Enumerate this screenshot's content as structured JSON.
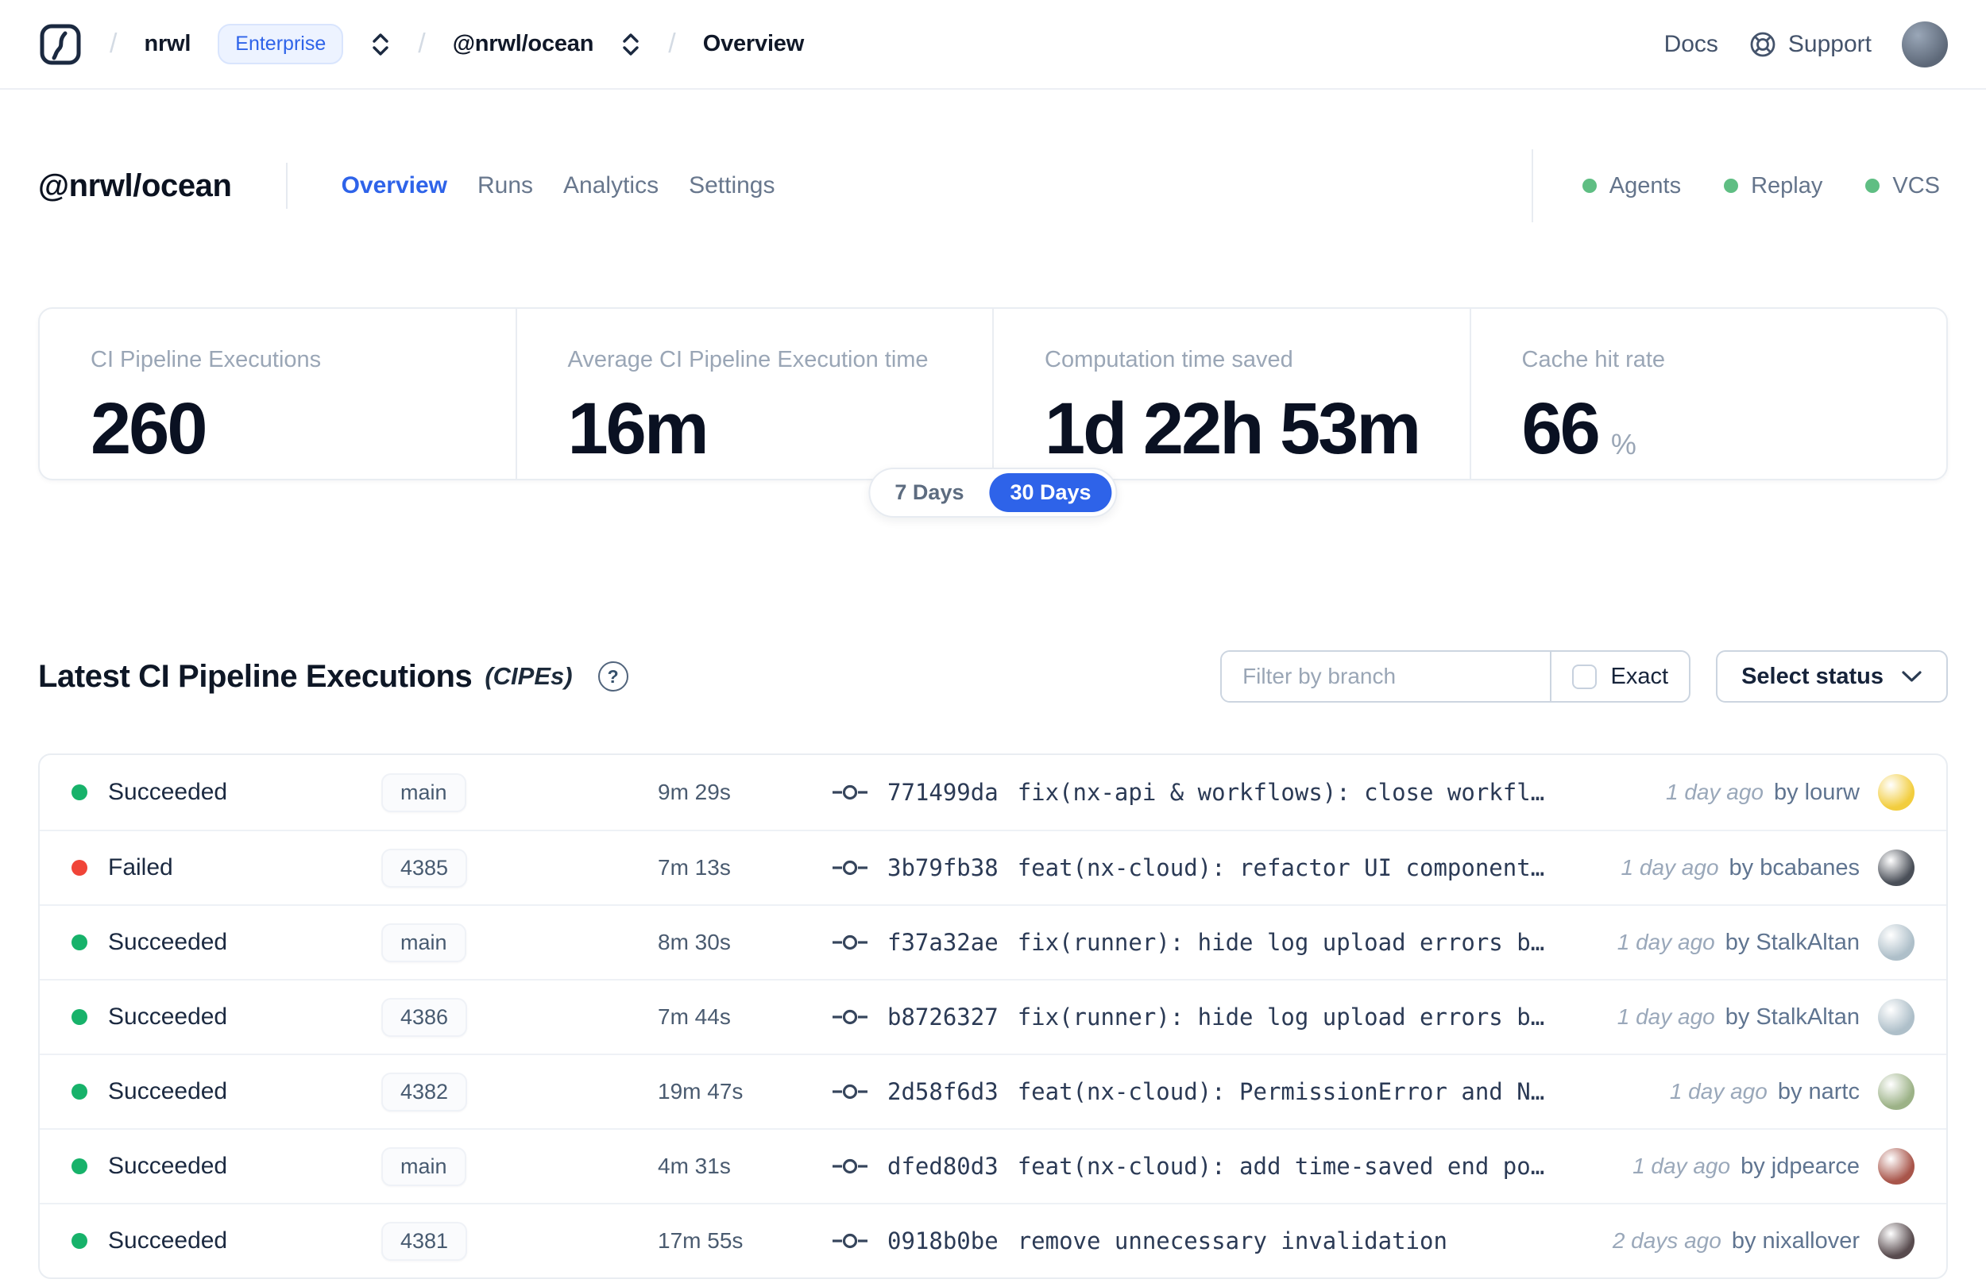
{
  "colors": {
    "primary": "#2e63e9",
    "success_dot": "#17b26a",
    "failed_dot": "#f04438",
    "header_dot": "#5fbe83"
  },
  "nav": {
    "separator": "/",
    "breadcrumb": {
      "org": "nrwl",
      "org_badge": "Enterprise",
      "workspace": "@nrwl/ocean",
      "page": "Overview"
    },
    "links": {
      "docs": "Docs",
      "support": "Support"
    }
  },
  "header": {
    "title": "@nrwl/ocean",
    "tabs": [
      {
        "label": "Overview",
        "active": true
      },
      {
        "label": "Runs",
        "active": false
      },
      {
        "label": "Analytics",
        "active": false
      },
      {
        "label": "Settings",
        "active": false
      }
    ],
    "statuses": [
      {
        "label": "Agents"
      },
      {
        "label": "Replay"
      },
      {
        "label": "VCS"
      }
    ]
  },
  "stats": {
    "cards": [
      {
        "label": "CI Pipeline Executions",
        "value": "260",
        "suffix": ""
      },
      {
        "label": "Average CI Pipeline Execution time",
        "value": "16m",
        "suffix": ""
      },
      {
        "label": "Computation time saved",
        "value": "1d 22h 53m",
        "suffix": ""
      },
      {
        "label": "Cache hit rate",
        "value": "66",
        "suffix": "%"
      }
    ],
    "range_toggle": {
      "options": [
        {
          "label": "7 Days",
          "active": false
        },
        {
          "label": "30 Days",
          "active": true
        }
      ]
    }
  },
  "cipe_section": {
    "title": "Latest CI Pipeline Executions",
    "title_suffix": "(CIPEs)",
    "help_icon": "?",
    "filter": {
      "placeholder": "Filter by branch",
      "exact_label": "Exact"
    },
    "status_select": {
      "label": "Select status"
    }
  },
  "table": {
    "rows": [
      {
        "status": "Succeeded",
        "branch": "main",
        "duration": "9m 29s",
        "commit_hash": "771499da",
        "commit_message": "fix(nx-api & workflows): close workfl…",
        "ago": "1 day ago",
        "author": "by lourw",
        "avatar_color": "#f2cd3e"
      },
      {
        "status": "Failed",
        "branch": "4385",
        "duration": "7m 13s",
        "commit_hash": "3b79fb38",
        "commit_message": "feat(nx-cloud): refactor UI component…",
        "ago": "1 day ago",
        "author": "by bcabanes",
        "avatar_color": "#4a4f58"
      },
      {
        "status": "Succeeded",
        "branch": "main",
        "duration": "8m 30s",
        "commit_hash": "f37a32ae",
        "commit_message": "fix(runner): hide log upload errors b…",
        "ago": "1 day ago",
        "author": "by StalkAltan",
        "avatar_color": "#aebfc9"
      },
      {
        "status": "Succeeded",
        "branch": "4386",
        "duration": "7m 44s",
        "commit_hash": "b8726327",
        "commit_message": "fix(runner): hide log upload errors b…",
        "ago": "1 day ago",
        "author": "by StalkAltan",
        "avatar_color": "#aebfc9"
      },
      {
        "status": "Succeeded",
        "branch": "4382",
        "duration": "19m 47s",
        "commit_hash": "2d58f6d3",
        "commit_message": "feat(nx-cloud): PermissionError and N…",
        "ago": "1 day ago",
        "author": "by nartc",
        "avatar_color": "#9cb287"
      },
      {
        "status": "Succeeded",
        "branch": "main",
        "duration": "4m 31s",
        "commit_hash": "dfed80d3",
        "commit_message": "feat(nx-cloud): add time-saved end po…",
        "ago": "1 day ago",
        "author": "by jdpearce",
        "avatar_color": "#a8554a"
      },
      {
        "status": "Succeeded",
        "branch": "4381",
        "duration": "17m 55s",
        "commit_hash": "0918b0be",
        "commit_message": "remove unnecessary invalidation",
        "ago": "2 days ago",
        "author": "by nixallover",
        "avatar_color": "#584b4e"
      }
    ]
  }
}
